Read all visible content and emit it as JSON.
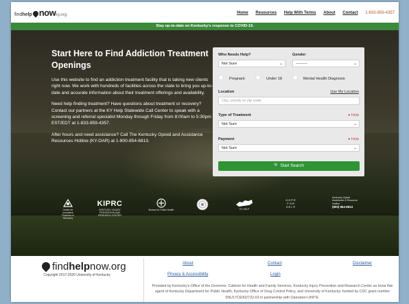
{
  "header": {
    "logo": {
      "pre": "find",
      "mid": "help",
      "now": "now",
      "suffix": "ky.org"
    },
    "nav": [
      "Home",
      "Resources",
      "Help With Terms",
      "About",
      "Contact"
    ],
    "phone": "1-833-859-4357"
  },
  "banner": "Stay up-to-date on Kentucky's response to COVID-19.",
  "hero": {
    "title": "Start Here to Find Addiction Treatment Openings",
    "paragraphs": [
      "Use this website to find an addiction treatment facility that is taking new clients right now. We work with hundreds of facilities across the state to bring you up-to-date and accurate information about their treatment offerings and availability.",
      "Need help finding treatment? Have questions about treatment or recovery? Contact our partners at the KY Help Statewide Call Center to speak with a screening and referral specialist Monday through Friday from 8:00am to 5:30pm EST/EDT at 1-833-859-4357.",
      "After hours and need assistance? Call The Kentucky Opioid and Assistance Resources Hotline (KY-OAR) at 1-800-854-6813."
    ]
  },
  "form": {
    "who_label": "Who Needs Help?",
    "who_value": "Not Sure",
    "gender_label": "Gender",
    "gender_value": "---------",
    "checks": [
      "Pregnant",
      "Under 18",
      "Mental Health Diagnosis"
    ],
    "location_label": "Location",
    "use_location": "Use My Location",
    "location_placeholder": "City, county or zip code",
    "treatment_label": "Type of Treatment",
    "treatment_value": "Not Sure",
    "payment_label": "Payment",
    "payment_value": "Not Sure",
    "help": "Help",
    "search_button": "Start Search"
  },
  "partners": [
    {
      "name": "CIPR",
      "caption": "Center for Innovative Practices in Recovery"
    },
    {
      "name": "KIPRC",
      "caption": "KENTUCKY INJURY PREVENTION AND RESEARCH CENTER"
    },
    {
      "name": "Bureau for Public Health",
      "caption": "Bureau for Public Health"
    },
    {
      "name": "seal",
      "caption": ""
    },
    {
      "name": "KY Help",
      "caption": "KY HELP"
    },
    {
      "name": "HOPE FOR HELP",
      "caption": "HOPE FOR HELP"
    },
    {
      "name": "ky-oar",
      "caption": "Kentucky Opioid Assistance & Resource Hotline",
      "phone": "(800) 854-6813"
    }
  ],
  "footer": {
    "logo": {
      "pre": "find",
      "mid": "help",
      "suffix": "now.org"
    },
    "copyright": "Copyright 2017-2020 University of Kentucky",
    "links": [
      "About",
      "Contact",
      "Disclaimer",
      "Privacy & Accessibility",
      "Login"
    ],
    "note": "Provided by Kentucky's Office of the Governor, Cabinet for Health and Family Services, Kentucky Injury Prevention and Research Center as bona fide agent of Kentucky Department for Public Health, Kentucky Office of Drug Control Policy, and University of Kentucky; funded by CDC grant number 5NU17CE002732-03 in partnership with Operation UNITE."
  }
}
